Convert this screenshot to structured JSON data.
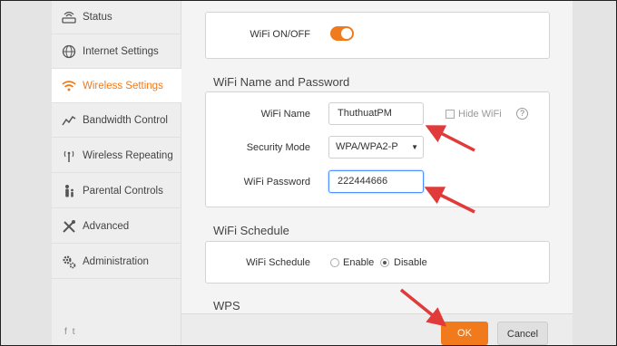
{
  "sidebar": {
    "items": [
      {
        "label": "Status",
        "icon": "status-icon"
      },
      {
        "label": "Internet Settings",
        "icon": "globe-icon"
      },
      {
        "label": "Wireless Settings",
        "icon": "wifi-icon",
        "active": true
      },
      {
        "label": "Bandwidth Control",
        "icon": "bandwidth-icon"
      },
      {
        "label": "Wireless Repeating",
        "icon": "antenna-icon"
      },
      {
        "label": "Parental Controls",
        "icon": "parental-icon"
      },
      {
        "label": "Advanced",
        "icon": "tools-icon"
      },
      {
        "label": "Administration",
        "icon": "gears-icon"
      }
    ],
    "social": {
      "facebook": "f",
      "twitter": "t"
    }
  },
  "wifi_toggle": {
    "label": "WiFi ON/OFF",
    "state": "on"
  },
  "name_password": {
    "title": "WiFi Name and Password",
    "wifi_name_label": "WiFi Name",
    "wifi_name_value": "ThuthuatPM",
    "hide_wifi_label": "Hide WiFi",
    "help": "?",
    "security_mode_label": "Security Mode",
    "security_mode_value": "WPA/WPA2-P",
    "wifi_password_label": "WiFi Password",
    "wifi_password_value": "222444666"
  },
  "schedule": {
    "title": "WiFi Schedule",
    "label": "WiFi Schedule",
    "enable_label": "Enable",
    "disable_label": "Disable",
    "selected": "Disable"
  },
  "wps": {
    "title": "WPS"
  },
  "footer": {
    "ok_label": "OK",
    "cancel_label": "Cancel"
  },
  "colors": {
    "accent": "#f07a1c",
    "annotation": "#e03a3a"
  }
}
